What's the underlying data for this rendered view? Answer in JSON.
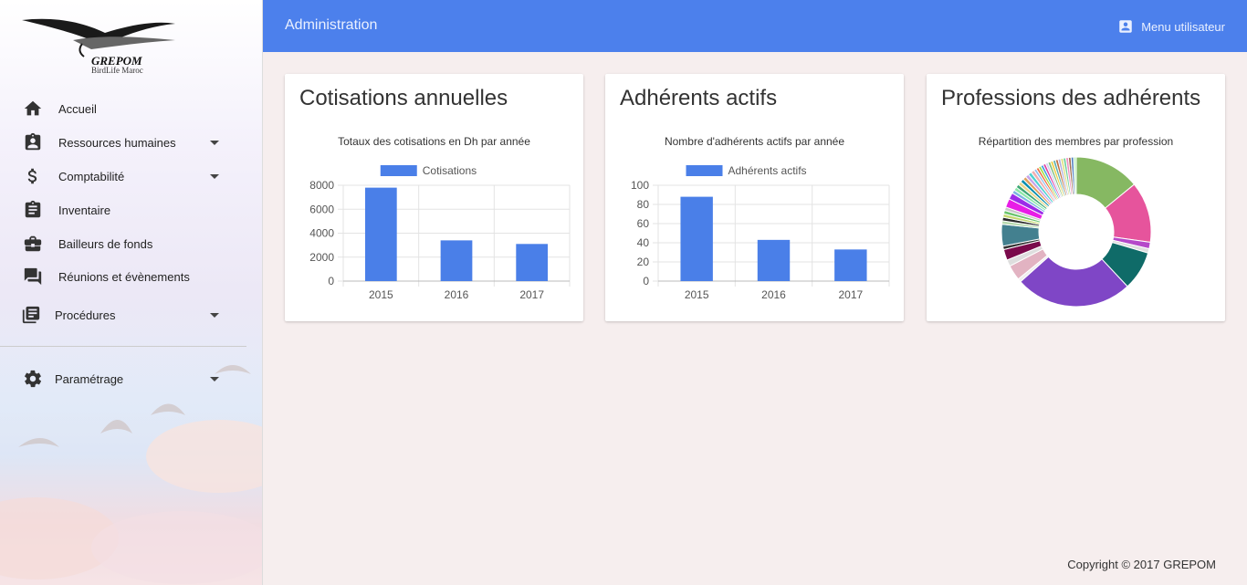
{
  "logo": {
    "title": "GREPOM",
    "subtitle": "BirdLife Maroc"
  },
  "sidebar": {
    "items": [
      {
        "label": "Accueil",
        "icon": "home-icon",
        "caret": false
      },
      {
        "label": "Ressources humaines",
        "icon": "badge-icon",
        "caret": true
      },
      {
        "label": "Comptabilité",
        "icon": "dollar-icon",
        "caret": true
      },
      {
        "label": "Inventaire",
        "icon": "clipboard-icon",
        "caret": false
      },
      {
        "label": "Bailleurs de fonds",
        "icon": "briefcase-icon",
        "caret": false
      },
      {
        "label": "Réunions et évènements",
        "icon": "forum-icon",
        "caret": false
      },
      {
        "label": "Procédures",
        "icon": "library-books-icon",
        "caret": true
      },
      {
        "label": "Paramétrage",
        "icon": "gear-icon",
        "caret": true
      }
    ]
  },
  "topbar": {
    "title": "Administration",
    "user_menu": "Menu utilisateur"
  },
  "cards": {
    "cotisations": {
      "heading": "Cotisations annuelles"
    },
    "adherents": {
      "heading": "Adhérents actifs"
    },
    "professions": {
      "heading": "Professions des adhérents"
    }
  },
  "footer": {
    "copyright": "Copyright © 2017 GREPOM"
  },
  "colors": {
    "accent": "#4c80ec",
    "bar": "#4a7fe8"
  },
  "chart_data": [
    {
      "type": "bar",
      "title": "Totaux des cotisations en Dh par année",
      "categories": [
        "2015",
        "2016",
        "2017"
      ],
      "series": [
        {
          "name": "Cotisations",
          "values": [
            7800,
            3400,
            3100
          ]
        }
      ],
      "ylim": [
        0,
        8000
      ],
      "yticks": [
        0,
        2000,
        4000,
        6000,
        8000
      ],
      "legend": "top",
      "grid": true
    },
    {
      "type": "bar",
      "title": "Nombre d'adhérents actifs par année",
      "categories": [
        "2015",
        "2016",
        "2017"
      ],
      "series": [
        {
          "name": "Adhérents actifs",
          "values": [
            88,
            43,
            33
          ]
        }
      ],
      "ylim": [
        0,
        100
      ],
      "yticks": [
        0,
        20,
        40,
        60,
        80,
        100
      ],
      "legend": "top",
      "grid": true
    },
    {
      "type": "pie",
      "title": "Répartition des membres par profession",
      "donut": true,
      "values": [
        15,
        14,
        1.5,
        1,
        9,
        27,
        0.8,
        3.5,
        1.5,
        2.5,
        0.8,
        5,
        0.8,
        0.8,
        0.8,
        0.8,
        0.8,
        2,
        1.5,
        0.8,
        0.8,
        0.8,
        0.8,
        0.8,
        0.8,
        0.8,
        0.8,
        0.8,
        0.6,
        0.6,
        0.6,
        0.6,
        0.6,
        0.6,
        0.6,
        0.6,
        0.6,
        0.6,
        0.6,
        0.6,
        0.6,
        0.6,
        0.6,
        0.6,
        0.6
      ],
      "colors": [
        "#86b862",
        "#e6549c",
        "#b549c9",
        "#dedede",
        "#0f6b68",
        "#7f46c6",
        "#eeeeee",
        "#e2b3c2",
        "#dedede",
        "#7a0a4b",
        "#333333",
        "#43808f",
        "#b7d9ad",
        "#2a2a2a",
        "#c5d970",
        "#6ac46a",
        "#c8c8c8",
        "#e81ce6",
        "#9b2de8",
        "#7bb6e0",
        "#8ce8a8",
        "#3fa877",
        "#e8d68c",
        "#0a8fb0",
        "#e0a060",
        "#c6a3e8",
        "#4fd1d1",
        "#f0b0b0",
        "#90c0f0",
        "#f07040",
        "#a0e040",
        "#40a0e0",
        "#e040a0",
        "#d0d0f0",
        "#80c080",
        "#f0d040",
        "#60b0b0",
        "#c07040",
        "#b0b0e0",
        "#e0e080",
        "#70d0a0",
        "#f090c0",
        "#a07050",
        "#5080c0",
        "#c0f0c0"
      ]
    }
  ]
}
